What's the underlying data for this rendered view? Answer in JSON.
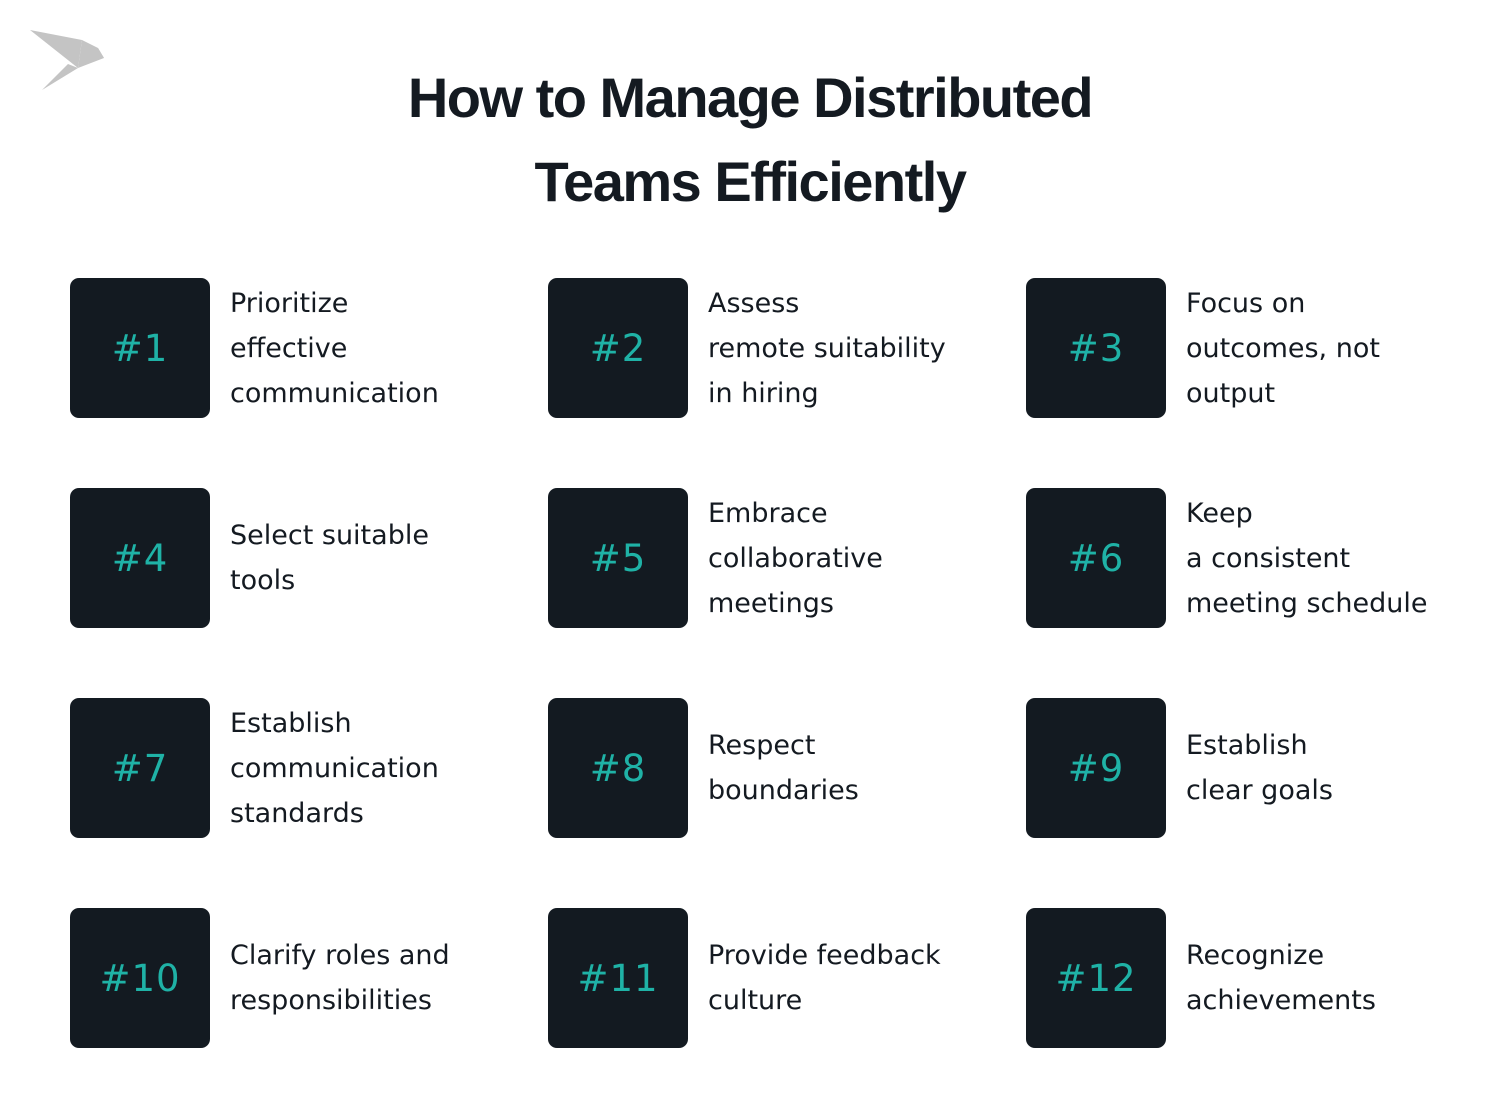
{
  "logo": {
    "icon": "origami-bird-icon",
    "color": "#c4c4c4"
  },
  "title": {
    "lines": [
      "How to Manage Distributed",
      "Teams Efficiently"
    ]
  },
  "colors": {
    "badge_bg": "#131a21",
    "badge_text": "#1fb2a6",
    "text": "#141a21",
    "background": "#ffffff"
  },
  "items": [
    {
      "number": "#1",
      "lines": [
        "Prioritize",
        "effective",
        "communication"
      ]
    },
    {
      "number": "#2",
      "lines": [
        "Assess",
        "remote suitability",
        "in hiring"
      ]
    },
    {
      "number": "#3",
      "lines": [
        "Focus on",
        "outcomes, not",
        "output"
      ]
    },
    {
      "number": "#4",
      "lines": [
        "Select suitable",
        "tools"
      ]
    },
    {
      "number": "#5",
      "lines": [
        "Embrace",
        "collaborative",
        "meetings"
      ]
    },
    {
      "number": "#6",
      "lines": [
        "Keep",
        "a consistent",
        "meeting schedule"
      ]
    },
    {
      "number": "#7",
      "lines": [
        "Establish",
        "communication",
        "standards"
      ]
    },
    {
      "number": "#8",
      "lines": [
        "Respect",
        "boundaries"
      ]
    },
    {
      "number": "#9",
      "lines": [
        "Establish",
        "clear goals"
      ]
    },
    {
      "number": "#10",
      "lines": [
        "Clarify roles and",
        "responsibilities"
      ]
    },
    {
      "number": "#11",
      "lines": [
        "Provide feedback",
        "culture"
      ]
    },
    {
      "number": "#12",
      "lines": [
        "Recognize",
        "achievements"
      ]
    }
  ]
}
